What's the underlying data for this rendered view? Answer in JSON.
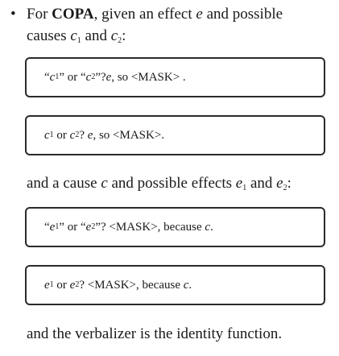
{
  "bullet": {
    "glyph": "•",
    "intro": "For ",
    "task": "COPA",
    "text1": ", given an effect ",
    "var_e": "e",
    "text2": " and possible",
    "line2_a": "causes ",
    "c": "c",
    "sub1": "1",
    "and": " and ",
    "sub2": "2",
    "colon": ":"
  },
  "causes_mid": {
    "a": "and a cause ",
    "c": "c",
    "b": " and possible effects ",
    "e": "e",
    "sub1": "1",
    "and": " and ",
    "sub2": "2",
    "colon": ":"
  },
  "closing": "and the verbalizer is the identity function.",
  "templates": {
    "t1": {
      "q1": "“",
      "v": "c",
      "s1": "1",
      "mid": "” or “",
      "s2": "2",
      "q2": "”? ",
      "e": "e",
      "tail": ", so <MASK> ."
    },
    "t2": {
      "v": "c",
      "s1": "1",
      "or": " or ",
      "s2": "2",
      "q": "? ",
      "e": "e",
      "tail": ", so <MASK>."
    },
    "t3": {
      "q1": "“",
      "v": "e",
      "s1": "1",
      "mid": "” or “",
      "s2": "2",
      "q2": "”? <MASK>, because ",
      "c": "c",
      "dot": "."
    },
    "t4": {
      "v": "e",
      "s1": "1",
      "or": " or ",
      "s2": "2",
      "q": "? <MASK>, because ",
      "c": "c",
      "dot": "."
    }
  }
}
